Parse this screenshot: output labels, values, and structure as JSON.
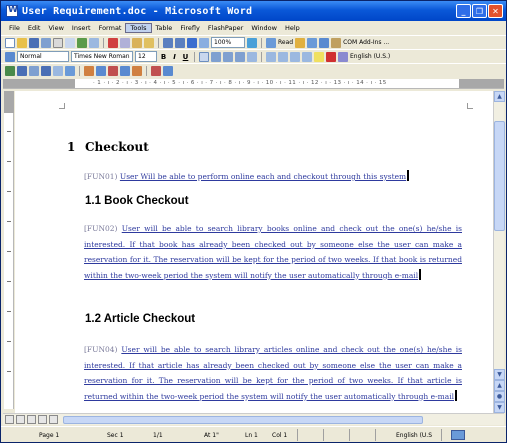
{
  "window": {
    "title": "User Requirement.doc - Microsoft Word"
  },
  "menu": [
    "File",
    "Edit",
    "View",
    "Insert",
    "Format",
    "Tools",
    "Table",
    "Firefly",
    "FlashPaper",
    "Window",
    "Help"
  ],
  "menu_active": "Tools",
  "toolbar": {
    "zoom": "100%",
    "read": "Read",
    "com_addins": "COM Add-Ins ...",
    "style": "Normal",
    "font": "Times New Roman",
    "size": "12",
    "bold": "B",
    "italic": "I",
    "underline": "U",
    "language": "English (U.S.)"
  },
  "document": {
    "heading1": {
      "number": "1",
      "text": "Checkout"
    },
    "fun1": {
      "tag": "[FUN01)",
      "text": "User Will be able to perform online each and checkout through this system"
    },
    "heading2a": "1.1  Book Checkout",
    "fun2": {
      "tag": "[FUN02)",
      "text": "User will be able to search library books online and check out the one(s) he/she is interested. If that book has already been checked out by someone else the user can make a reservation for it. The reservation will be kept for the period of two weeks. If that book is returned within the two-week period the system will notify the user automatically through e-mail"
    },
    "heading2b": "1.2  Article Checkout",
    "fun3": {
      "tag": "[FUN04)",
      "text": "User will be able to search library articles online and check out the one(s) he/she is interested. If that article has already been checked out by someone else the user can make a reservation for it. The reservation will be kept for the period of two weeks. If that article is returned within the two-week period the system will notify the user automatically through e-mail"
    }
  },
  "status": {
    "page": "Page 1",
    "sec": "Sec 1",
    "pages": "1/1",
    "at": "At 1\"",
    "ln": "Ln 1",
    "col": "Col 1",
    "language": "English (U.S",
    "mode_icon": "book-icon"
  },
  "colors": {
    "title_bar": "#0a58d8",
    "link_text": "#2e3a9e",
    "chrome": "#ece9d8"
  }
}
